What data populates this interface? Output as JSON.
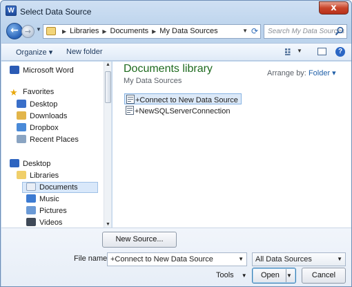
{
  "window": {
    "title": "Select Data Source",
    "app_icon_letter": "W",
    "close_glyph": "x"
  },
  "nav": {
    "back_glyph": "←",
    "forward_glyph": "→",
    "breadcrumb": [
      "Libraries",
      "Documents",
      "My Data Sources"
    ],
    "search_placeholder": "Search My Data Sources"
  },
  "toolbar": {
    "organize": "Organize ▾",
    "new_folder": "New folder",
    "help": "?"
  },
  "sidebar": {
    "items": [
      {
        "label": "Microsoft Word",
        "icon": "word-icon"
      },
      {
        "label": "Favorites",
        "icon": "star-icon"
      },
      {
        "label": "Desktop",
        "icon": "desktop-icon"
      },
      {
        "label": "Downloads",
        "icon": "downloads-icon"
      },
      {
        "label": "Dropbox",
        "icon": "dropbox-icon"
      },
      {
        "label": "Recent Places",
        "icon": "recent-places-icon"
      },
      {
        "label": "Desktop",
        "icon": "desktop-icon"
      },
      {
        "label": "Libraries",
        "icon": "libraries-icon"
      },
      {
        "label": "Documents",
        "icon": "documents-icon",
        "selected": true
      },
      {
        "label": "Music",
        "icon": "music-icon"
      },
      {
        "label": "Pictures",
        "icon": "pictures-icon"
      },
      {
        "label": "Videos",
        "icon": "videos-icon"
      }
    ]
  },
  "content": {
    "library_title": "Documents library",
    "library_subtitle": "My Data Sources",
    "arrange_label": "Arrange by:",
    "arrange_value": "Folder ▾",
    "files": [
      {
        "name": "+Connect to New Data Source",
        "selected": true
      },
      {
        "name": "+NewSQLServerConnection",
        "selected": false
      }
    ]
  },
  "footer": {
    "new_source": "New Source...",
    "file_name_label": "File name:",
    "file_name_value": "+Connect to New Data Source",
    "file_type_value": "All Data Sources",
    "tools": "Tools",
    "open": "Open",
    "cancel": "Cancel"
  },
  "colors": {
    "library_title": "#1e6a1e",
    "accent": "#1f5fa8",
    "close": "#c9452b"
  }
}
